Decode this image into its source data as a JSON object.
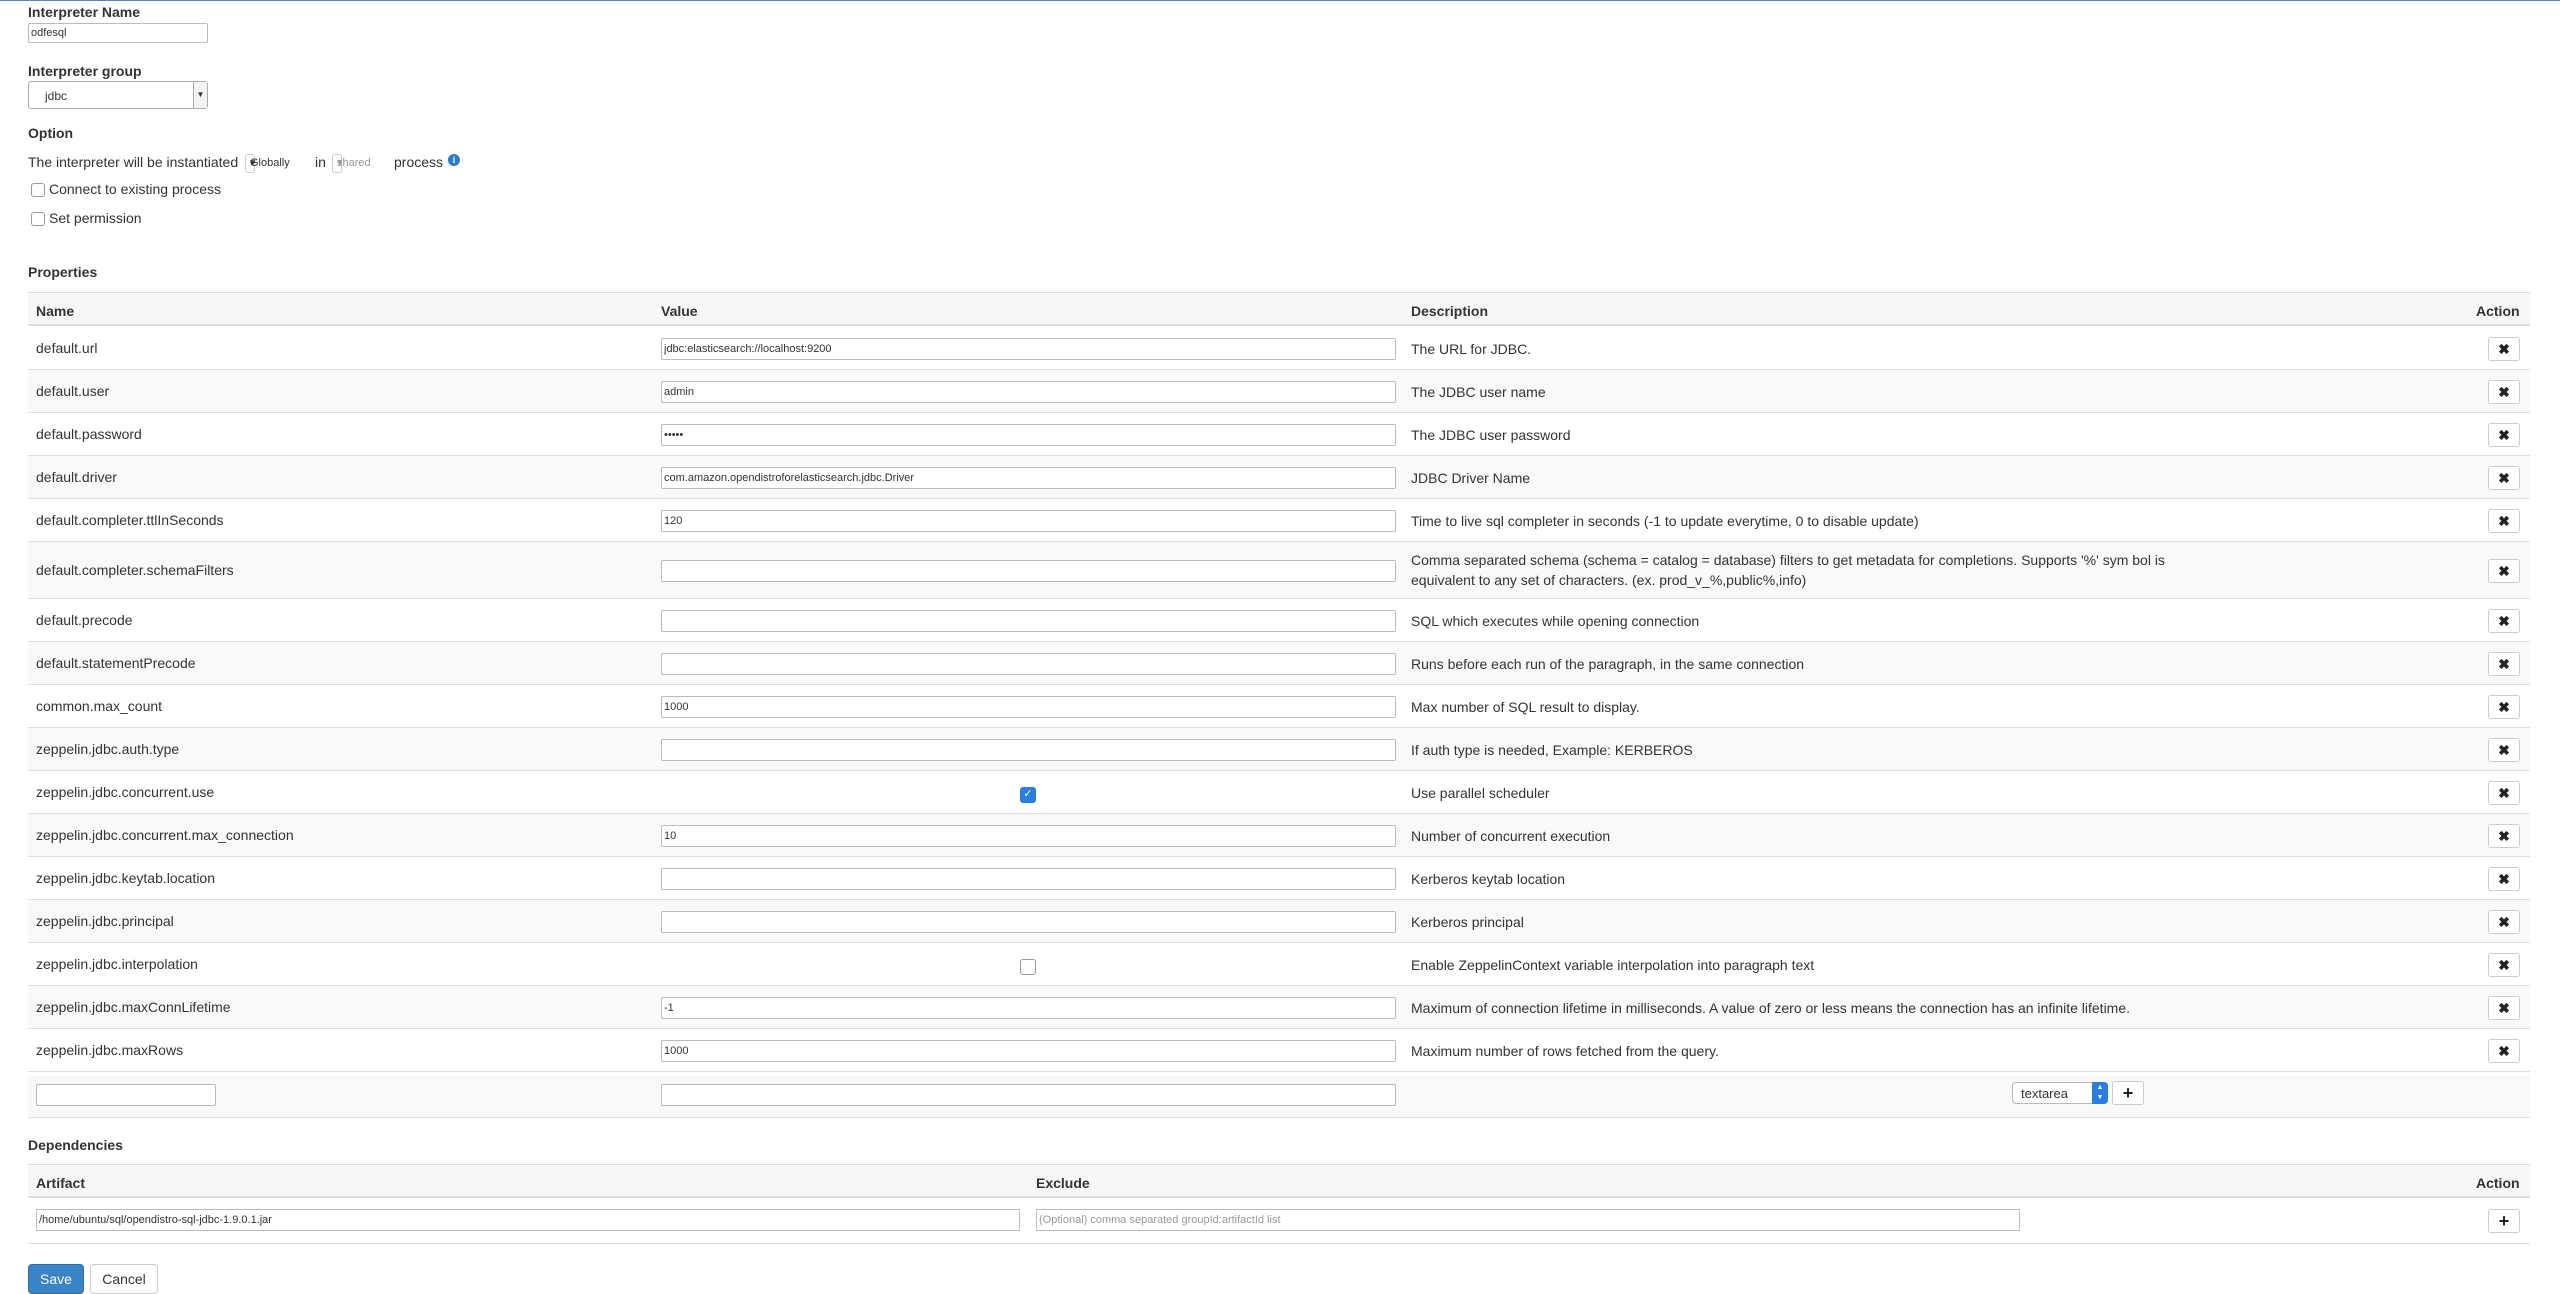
{
  "interpreter_name": {
    "label": "Interpreter Name",
    "value": "odfesql"
  },
  "interpreter_group": {
    "label": "Interpreter group",
    "value": "jdbc"
  },
  "option": {
    "heading": "Option",
    "text_before": "The interpreter will be instantiated",
    "scope_value": "Globally",
    "text_in": "in",
    "mode_value": "shared",
    "text_after": "process",
    "connect_existing_label": "Connect to existing process",
    "connect_existing_checked": false,
    "set_permission_label": "Set permission",
    "set_permission_checked": false
  },
  "properties": {
    "heading": "Properties",
    "columns": {
      "name": "Name",
      "value": "Value",
      "description": "Description",
      "action": "Action"
    },
    "rows": [
      {
        "name": "default.url",
        "value": "jdbc:elasticsearch://localhost:9200",
        "description": "The URL for JDBC."
      },
      {
        "name": "default.user",
        "value": "admin",
        "description": "The JDBC user name"
      },
      {
        "name": "default.password",
        "value": "•••••",
        "description": "The JDBC user password"
      },
      {
        "name": "default.driver",
        "value": "com.amazon.opendistroforelasticsearch.jdbc.Driver",
        "description": "JDBC Driver Name"
      },
      {
        "name": "default.completer.ttlInSeconds",
        "value": "120",
        "description": "Time to live sql completer in seconds (-1 to update everytime, 0 to disable update)"
      },
      {
        "name": "default.completer.schemaFilters",
        "value": "",
        "description": "Comma separated schema (schema = catalog = database) filters to get metadata for completions. Supports '%' sym bol is equivalent to any set of characters. (ex. prod_v_%,public%,info)"
      },
      {
        "name": "default.precode",
        "value": "",
        "description": "SQL which executes while opening connection"
      },
      {
        "name": "default.statementPrecode",
        "value": "",
        "description": "Runs before each run of the paragraph, in the same connection"
      },
      {
        "name": "common.max_count",
        "value": "1000",
        "description": "Max number of SQL result to display."
      },
      {
        "name": "zeppelin.jdbc.auth.type",
        "value": "",
        "description": "If auth type is needed, Example: KERBEROS"
      },
      {
        "name": "zeppelin.jdbc.concurrent.use",
        "checkbox": true,
        "checked": true,
        "description": "Use parallel scheduler"
      },
      {
        "name": "zeppelin.jdbc.concurrent.max_connection",
        "value": "10",
        "description": "Number of concurrent execution"
      },
      {
        "name": "zeppelin.jdbc.keytab.location",
        "value": "",
        "description": "Kerberos keytab location"
      },
      {
        "name": "zeppelin.jdbc.principal",
        "value": "",
        "description": "Kerberos principal"
      },
      {
        "name": "zeppelin.jdbc.interpolation",
        "checkbox": true,
        "checked": false,
        "description": "Enable ZeppelinContext variable interpolation into paragraph text"
      },
      {
        "name": "zeppelin.jdbc.maxConnLifetime",
        "value": "-1",
        "description": "Maximum of connection lifetime in milliseconds. A value of zero or less means the connection has an infinite lifetime."
      },
      {
        "name": "zeppelin.jdbc.maxRows",
        "value": "1000",
        "description": "Maximum number of rows fetched from the query."
      }
    ],
    "new_row": {
      "name": "",
      "value": "",
      "type": "textarea"
    }
  },
  "dependencies": {
    "heading": "Dependencies",
    "columns": {
      "artifact": "Artifact",
      "exclude": "Exclude",
      "action": "Action"
    },
    "artifact_value": "/home/ubuntu/sql/opendistro-sql-jdbc-1.9.0.1.jar",
    "exclude_placeholder": "(Optional) comma separated groupId:artifactId list"
  },
  "buttons": {
    "save": "Save",
    "cancel": "Cancel"
  }
}
